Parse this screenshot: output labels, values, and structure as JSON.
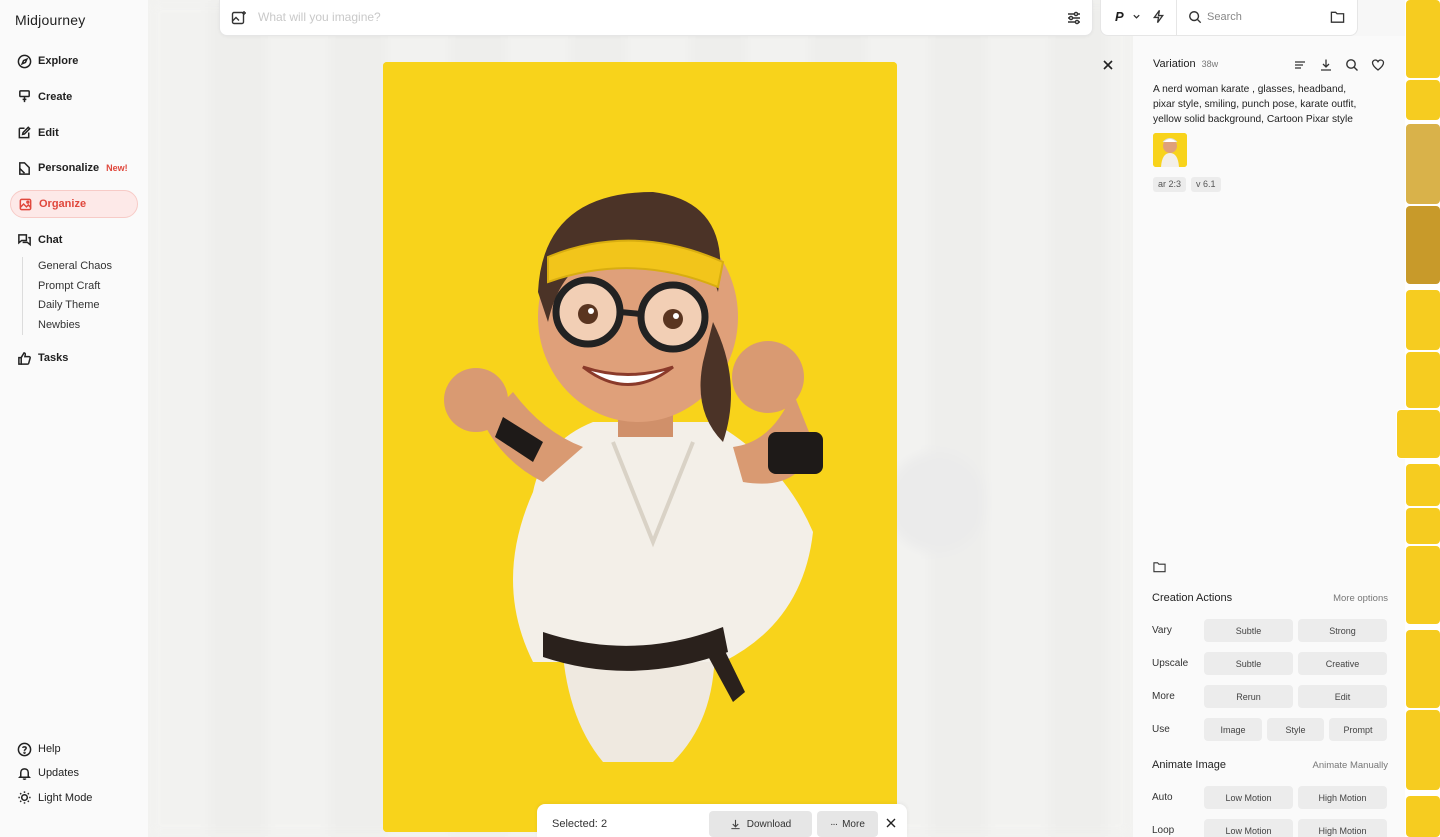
{
  "app": {
    "name": "Midjourney"
  },
  "nav": {
    "items": [
      {
        "label": "Explore",
        "icon": "compass-icon"
      },
      {
        "label": "Create",
        "icon": "brush-icon"
      },
      {
        "label": "Edit",
        "icon": "edit-icon"
      },
      {
        "label": "Personalize",
        "icon": "personalize-icon",
        "badge": "New!"
      },
      {
        "label": "Organize",
        "icon": "image-icon",
        "active": true
      },
      {
        "label": "Chat",
        "icon": "chat-icon"
      }
    ],
    "chats": [
      "General Chaos",
      "Prompt Craft",
      "Daily Theme",
      "Newbies"
    ],
    "tasks_label": "Tasks",
    "bottom": [
      {
        "label": "Help",
        "icon": "help-icon"
      },
      {
        "label": "Updates",
        "icon": "bell-icon"
      },
      {
        "label": "Light Mode",
        "icon": "sun-icon"
      }
    ]
  },
  "prompt_bar": {
    "placeholder": "What will you imagine?"
  },
  "top_right": {
    "mode": "P",
    "search_label": "Search"
  },
  "selection": {
    "label": "Selected:",
    "count": "2",
    "download": "Download",
    "more": "More"
  },
  "detail": {
    "title": "Variation",
    "age": "38w",
    "prompt": "A nerd woman karate , glasses, headband, pixar style, smiling, punch pose, karate outfit, yellow solid background, Cartoon Pixar style",
    "tags": [
      "ar 2:3",
      "v 6.1"
    ],
    "creation_actions": {
      "title": "Creation Actions",
      "link": "More options",
      "rows": [
        {
          "label": "Vary",
          "buttons": [
            "Subtle",
            "Strong"
          ]
        },
        {
          "label": "Upscale",
          "buttons": [
            "Subtle",
            "Creative"
          ]
        },
        {
          "label": "More",
          "buttons": [
            "Rerun",
            "Edit"
          ]
        },
        {
          "label": "Use",
          "buttons": [
            "Image",
            "Style",
            "Prompt"
          ]
        }
      ]
    },
    "animate": {
      "title": "Animate Image",
      "link": "Animate Manually",
      "rows": [
        {
          "label": "Auto",
          "buttons": [
            "Low Motion",
            "High Motion"
          ]
        },
        {
          "label": "Loop",
          "buttons": [
            "Low Motion",
            "High Motion"
          ]
        }
      ]
    }
  },
  "colors": {
    "accent": "#e0473c",
    "image_bg": "#f8d31b"
  }
}
